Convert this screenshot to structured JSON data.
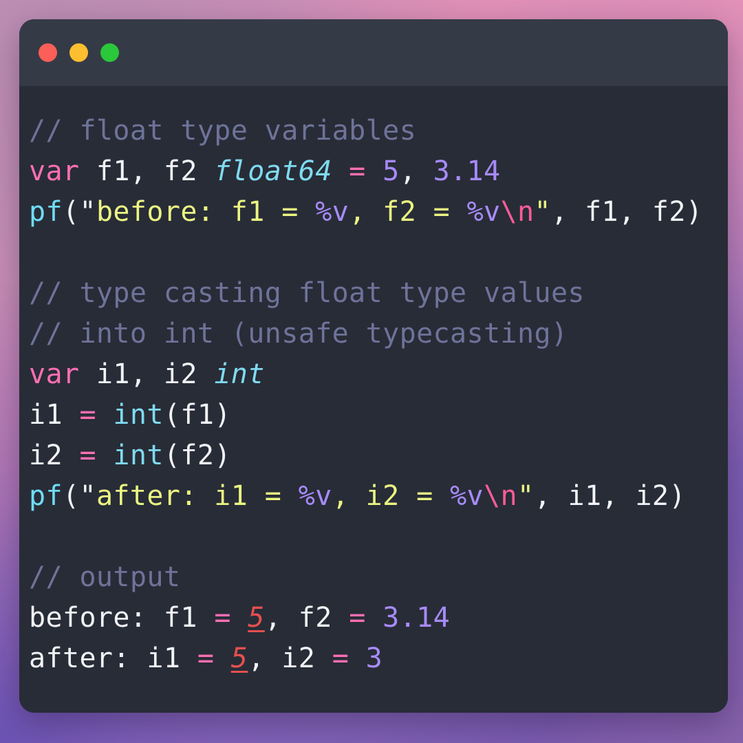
{
  "window": {
    "background_colors": {
      "top_left": "#bd8eb4",
      "top_right": "#e491b8",
      "bottom_left": "#6750b4",
      "bottom_right": "#8661ab"
    },
    "titlebar_color": "#353a47",
    "body_color": "#282c37",
    "traffic_lights": [
      {
        "name": "close",
        "color": "#fc5f58"
      },
      {
        "name": "minimize",
        "color": "#fdbe2f"
      },
      {
        "name": "maximize",
        "color": "#2ac83a"
      }
    ]
  },
  "code": {
    "language": "go",
    "lines": [
      {
        "id": "line-1",
        "tokens": [
          {
            "text": "// float type variables",
            "cls": "t-comment"
          }
        ]
      },
      {
        "id": "line-2",
        "tokens": [
          {
            "text": "var",
            "cls": "t-keyword"
          },
          {
            "text": " f1, f2 ",
            "cls": "t-plain"
          },
          {
            "text": "float64",
            "cls": "t-type"
          },
          {
            "text": " ",
            "cls": "t-plain"
          },
          {
            "text": "=",
            "cls": "t-op"
          },
          {
            "text": " ",
            "cls": "t-plain"
          },
          {
            "text": "5",
            "cls": "t-number"
          },
          {
            "text": ", ",
            "cls": "t-plain"
          },
          {
            "text": "3.14",
            "cls": "t-number"
          }
        ]
      },
      {
        "id": "line-3",
        "tokens": [
          {
            "text": "pf",
            "cls": "t-func"
          },
          {
            "text": "(",
            "cls": "t-plain"
          },
          {
            "text": "\"",
            "cls": "t-quote"
          },
          {
            "text": "before: f1 = ",
            "cls": "t-string"
          },
          {
            "text": "%v",
            "cls": "t-verb"
          },
          {
            "text": ", f2 = ",
            "cls": "t-string"
          },
          {
            "text": "%v",
            "cls": "t-verb"
          },
          {
            "text": "\\n",
            "cls": "t-escape"
          },
          {
            "text": "\"",
            "cls": "t-quote-y"
          },
          {
            "text": ", f1, f2)",
            "cls": "t-plain"
          }
        ]
      },
      {
        "id": "line-4",
        "blank": true,
        "tokens": []
      },
      {
        "id": "line-5",
        "tokens": [
          {
            "text": "// type casting float type values",
            "cls": "t-comment"
          }
        ]
      },
      {
        "id": "line-6",
        "tokens": [
          {
            "text": "// into int (unsafe typecasting)",
            "cls": "t-comment"
          }
        ]
      },
      {
        "id": "line-7",
        "tokens": [
          {
            "text": "var",
            "cls": "t-keyword"
          },
          {
            "text": " i1, i2 ",
            "cls": "t-plain"
          },
          {
            "text": "int",
            "cls": "t-type"
          }
        ]
      },
      {
        "id": "line-8",
        "tokens": [
          {
            "text": "i1 ",
            "cls": "t-plain"
          },
          {
            "text": "=",
            "cls": "t-op"
          },
          {
            "text": " ",
            "cls": "t-plain"
          },
          {
            "text": "int",
            "cls": "t-builtin"
          },
          {
            "text": "(f1)",
            "cls": "t-plain"
          }
        ]
      },
      {
        "id": "line-9",
        "tokens": [
          {
            "text": "i2 ",
            "cls": "t-plain"
          },
          {
            "text": "=",
            "cls": "t-op"
          },
          {
            "text": " ",
            "cls": "t-plain"
          },
          {
            "text": "int",
            "cls": "t-builtin"
          },
          {
            "text": "(f2)",
            "cls": "t-plain"
          }
        ]
      },
      {
        "id": "line-10",
        "tokens": [
          {
            "text": "pf",
            "cls": "t-func"
          },
          {
            "text": "(",
            "cls": "t-plain"
          },
          {
            "text": "\"",
            "cls": "t-quote"
          },
          {
            "text": "after: i1 = ",
            "cls": "t-string"
          },
          {
            "text": "%v",
            "cls": "t-verb"
          },
          {
            "text": ", i2 = ",
            "cls": "t-string"
          },
          {
            "text": "%v",
            "cls": "t-verb"
          },
          {
            "text": "\\n",
            "cls": "t-escape"
          },
          {
            "text": "\"",
            "cls": "t-quote-y"
          },
          {
            "text": ", i1, i2)",
            "cls": "t-plain"
          }
        ]
      },
      {
        "id": "line-11",
        "blank": true,
        "tokens": []
      },
      {
        "id": "line-12",
        "tokens": [
          {
            "text": "// output",
            "cls": "t-comment"
          }
        ]
      },
      {
        "id": "line-13",
        "tokens": [
          {
            "text": "before: f1 ",
            "cls": "t-plain"
          },
          {
            "text": "=",
            "cls": "t-op"
          },
          {
            "text": " ",
            "cls": "t-plain"
          },
          {
            "text": "5",
            "cls": "t-error"
          },
          {
            "text": ", f2 ",
            "cls": "t-plain"
          },
          {
            "text": "=",
            "cls": "t-op"
          },
          {
            "text": " ",
            "cls": "t-plain"
          },
          {
            "text": "3.14",
            "cls": "t-number"
          }
        ]
      },
      {
        "id": "line-14",
        "tokens": [
          {
            "text": "after: i1 ",
            "cls": "t-plain"
          },
          {
            "text": "=",
            "cls": "t-op"
          },
          {
            "text": " ",
            "cls": "t-plain"
          },
          {
            "text": "5",
            "cls": "t-error"
          },
          {
            "text": ", i2 ",
            "cls": "t-plain"
          },
          {
            "text": "=",
            "cls": "t-op"
          },
          {
            "text": " ",
            "cls": "t-plain"
          },
          {
            "text": "3",
            "cls": "t-number"
          }
        ]
      }
    ]
  }
}
